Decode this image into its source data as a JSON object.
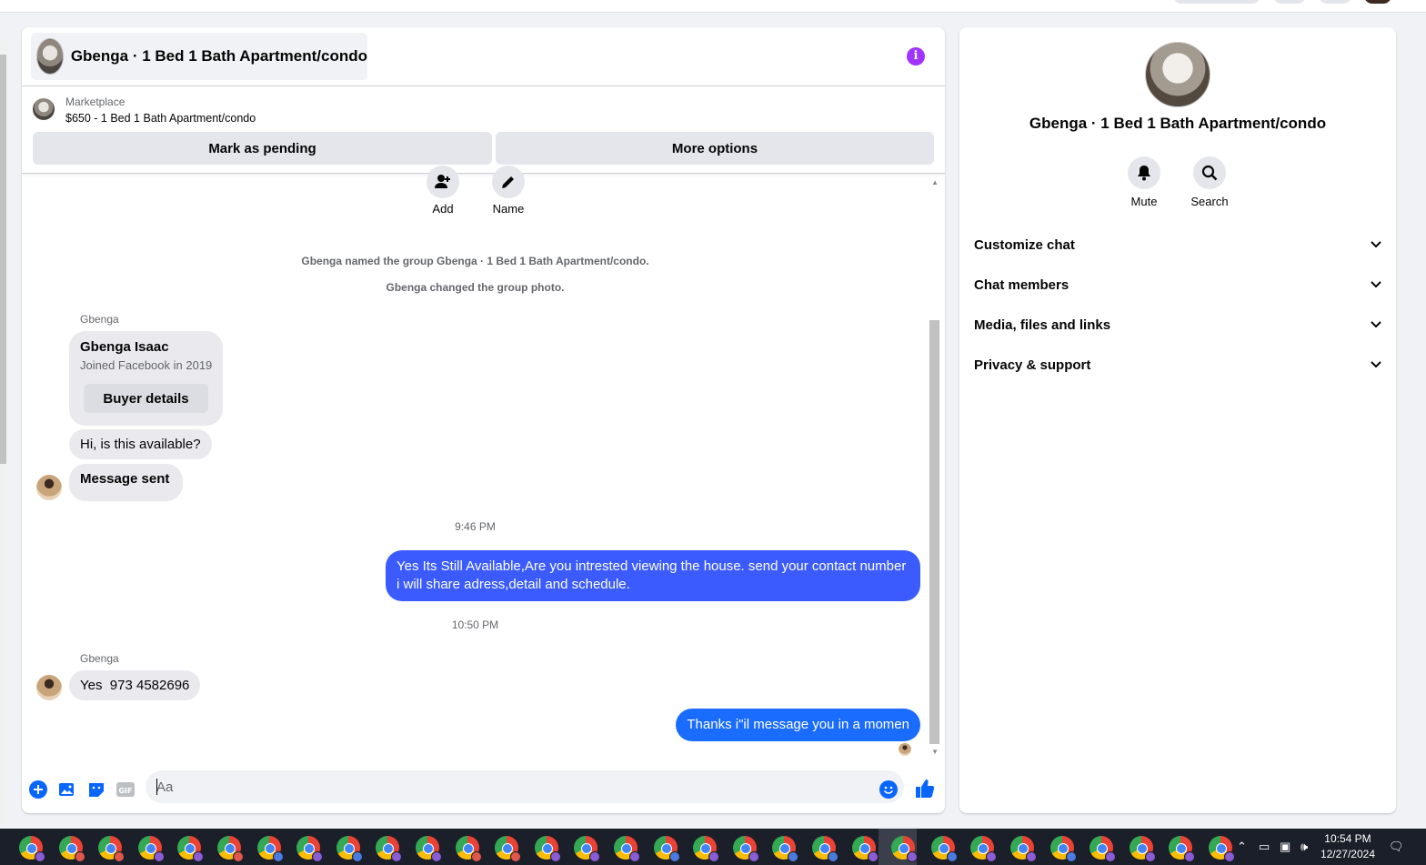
{
  "chat": {
    "title": "Gbenga · 1 Bed 1 Bath Apartment/condo",
    "marketplace_label": "Marketplace",
    "listing": "$650 - 1 Bed 1 Bath Apartment/condo",
    "mark_pending": "Mark as pending",
    "more_options": "More options",
    "add_label": "Add",
    "name_label": "Name",
    "system_messages": [
      "Gbenga named the group Gbenga · 1 Bed 1 Bath Apartment/condo.",
      "Gbenga changed the group photo."
    ],
    "buyer_card": {
      "sender": "Gbenga",
      "name": "Gbenga Isaac",
      "joined": "Joined Facebook in 2019",
      "button": "Buyer details"
    },
    "messages": [
      {
        "dir": "in",
        "text": "Hi, is this available?"
      },
      {
        "dir": "in",
        "text": "Message sent"
      },
      {
        "time": "9:46 PM"
      },
      {
        "dir": "out",
        "text": "Yes Its Still Available,Are you intrested viewing the house. send your contact number i will share adress,detail and schedule."
      },
      {
        "time": "10:50 PM"
      },
      {
        "dir": "in",
        "sender": "Gbenga",
        "text": "Yes  973 4582696"
      },
      {
        "dir": "out",
        "text": "Thanks i\"il message you in a momen"
      }
    ],
    "composer_placeholder": "Aa"
  },
  "side": {
    "title": "Gbenga · 1 Bed 1 Bath Apartment/condo",
    "mute": "Mute",
    "search": "Search",
    "sections": [
      "Customize chat",
      "Chat members",
      "Media, files and links",
      "Privacy & support"
    ]
  },
  "taskbar": {
    "time": "10:54 PM",
    "date": "12/27/2024",
    "app_icon": "chrome-icon"
  },
  "colors": {
    "outgoing_bubble": "#3b5bff",
    "accent": "#0866ff",
    "info": "#a033ff"
  }
}
